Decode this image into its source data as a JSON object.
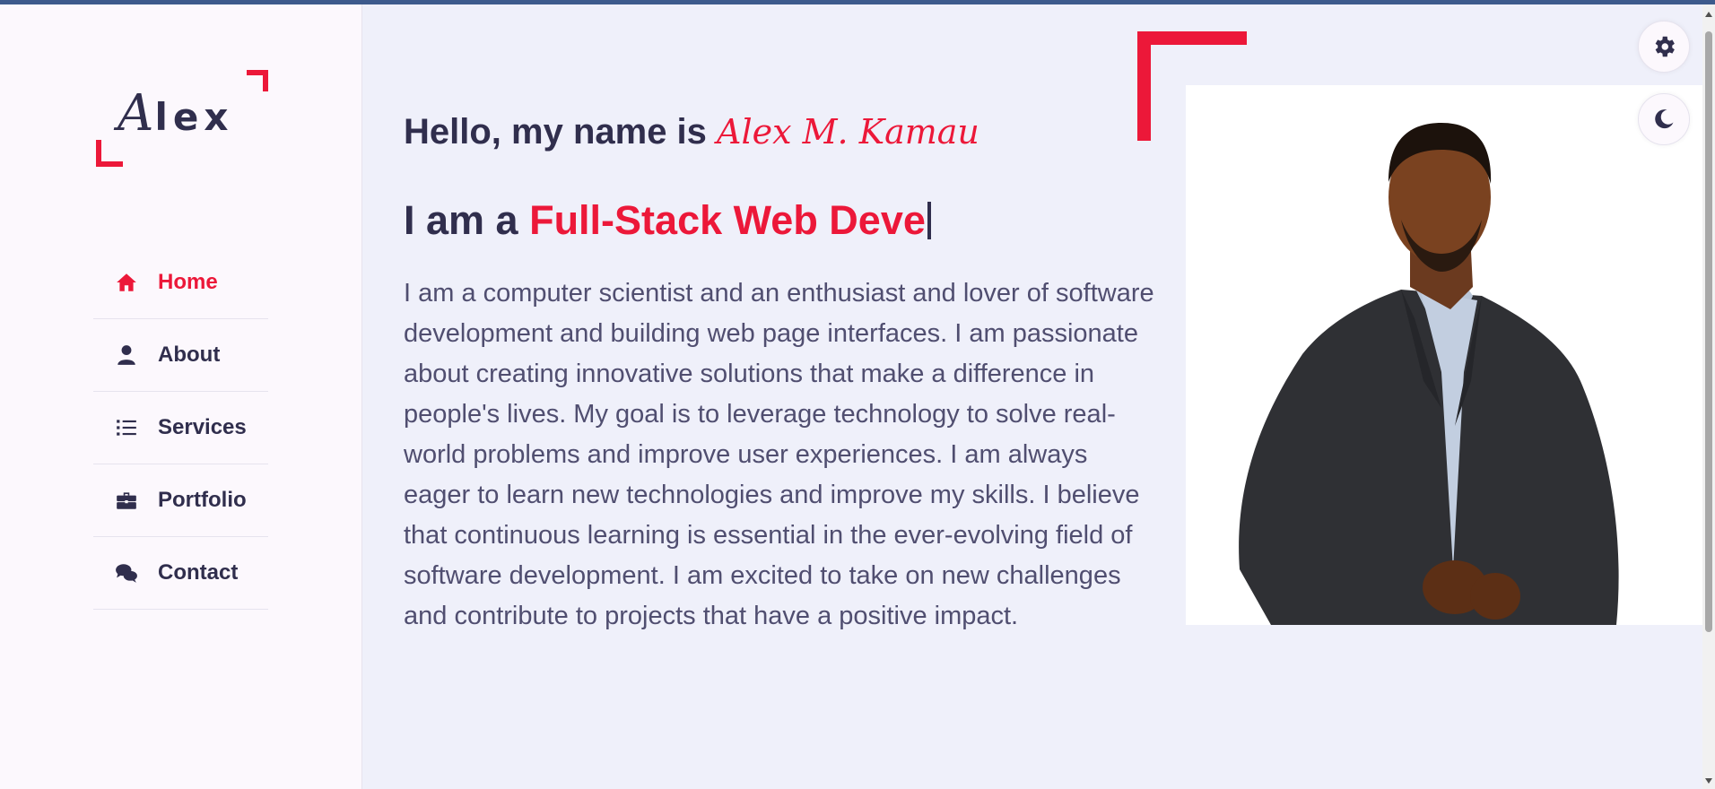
{
  "logo": {
    "first_letter": "A",
    "rest": "lex"
  },
  "nav": {
    "items": [
      {
        "label": "Home",
        "icon": "home-icon",
        "active": true
      },
      {
        "label": "About",
        "icon": "user-icon",
        "active": false
      },
      {
        "label": "Services",
        "icon": "list-icon",
        "active": false
      },
      {
        "label": "Portfolio",
        "icon": "briefcase-icon",
        "active": false
      },
      {
        "label": "Contact",
        "icon": "comments-icon",
        "active": false
      }
    ]
  },
  "hero": {
    "greeting": "Hello, my name is ",
    "name": "Alex M. Kamau",
    "role_prefix": "I am a ",
    "role_typed": "Full-Stack Web Deve",
    "bio": "I am a computer scientist and an enthusiast and lover of software development and building web page interfaces. I am passionate about creating innovative solutions that make a difference in people's lives. My goal is to leverage technology to solve real-world problems and improve user experiences. I am always eager to learn new technologies and improve my skills. I believe that continuous learning is essential in the ever-evolving field of software development. I am excited to take on new challenges and contribute to projects that have a positive impact."
  },
  "controls": {
    "settings_icon": "gear-icon",
    "theme_icon": "moon-icon"
  },
  "colors": {
    "accent": "#ec1839",
    "text_dark": "#302e4d",
    "text_body": "#504e70",
    "sidebar_bg": "#fcf8fd",
    "main_bg": "#eff0fa"
  }
}
